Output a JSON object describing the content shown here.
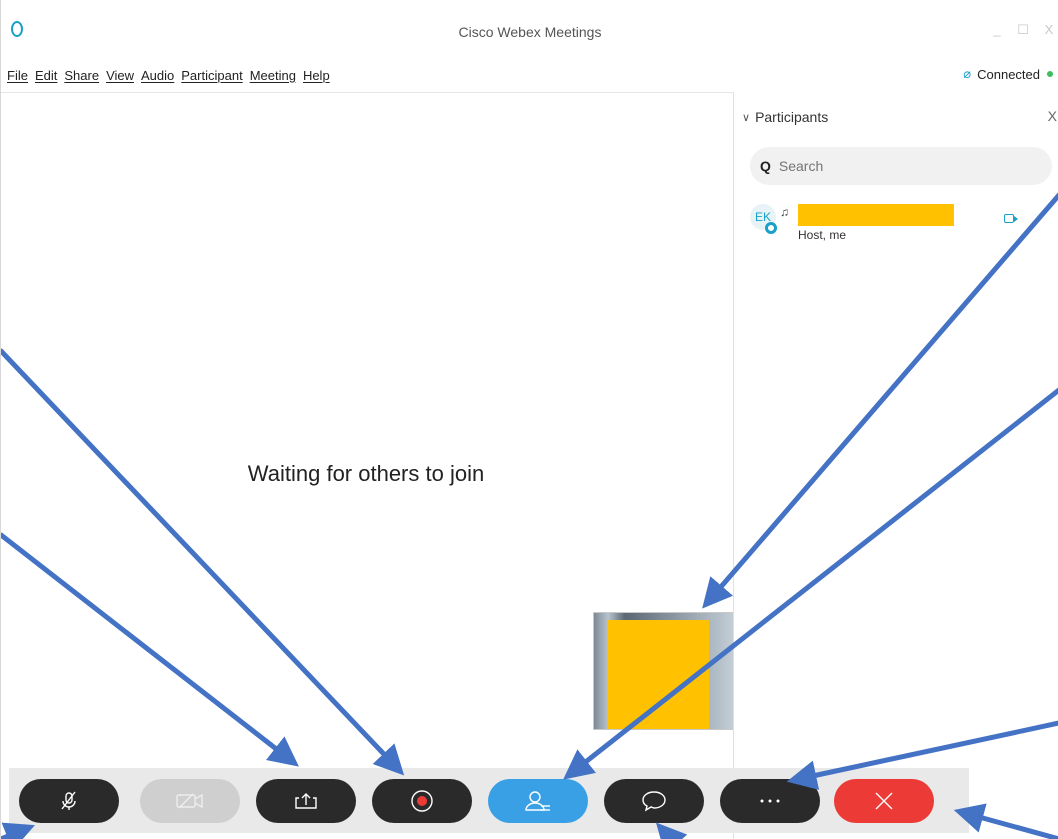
{
  "window": {
    "title": "Cisco Webex Meetings",
    "controls": {
      "minimize": "_",
      "maximize": "☐",
      "close": "X"
    }
  },
  "menu": [
    "File",
    "Edit",
    "Share",
    "View",
    "Audio",
    "Participant",
    "Meeting",
    "Help"
  ],
  "status": {
    "connection": "Connected",
    "connection_color": "#3dbd5e"
  },
  "stage": {
    "waiting_text": "Waiting for others to join"
  },
  "participants_panel": {
    "title": "Participants",
    "close_label": "X",
    "search_placeholder": "Search",
    "items": [
      {
        "initials": "EK",
        "role": "Host, me",
        "name_redacted": true,
        "video_on": true
      }
    ]
  },
  "controls": [
    {
      "id": "mute",
      "icon": "mic-muted-icon",
      "state": "normal"
    },
    {
      "id": "video",
      "icon": "video-off-icon",
      "state": "disabled"
    },
    {
      "id": "share",
      "icon": "share-icon",
      "state": "normal"
    },
    {
      "id": "record",
      "icon": "record-icon",
      "state": "normal"
    },
    {
      "id": "participants",
      "icon": "participants-icon",
      "state": "active"
    },
    {
      "id": "chat",
      "icon": "chat-icon",
      "state": "normal"
    },
    {
      "id": "more",
      "icon": "more-icon",
      "state": "normal"
    },
    {
      "id": "leave",
      "icon": "close-icon",
      "state": "danger"
    }
  ],
  "colors": {
    "accent": "#1aa0c8",
    "active_button": "#3aa0e6",
    "end_button": "#ec3b37",
    "dark_button": "#2a2a2a",
    "annotation_arrow": "#4472c4",
    "redaction": "#ffc100"
  }
}
